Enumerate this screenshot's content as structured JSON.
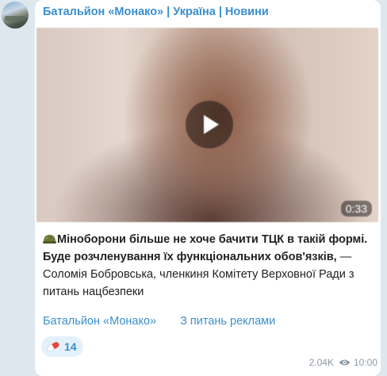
{
  "channel": {
    "title": "Батальйон «Монако» | Україна | Новини"
  },
  "video": {
    "duration": "0:33"
  },
  "post": {
    "headline": "Міноборони більше не хоче бачити ТЦК в такій формі. Буде розчленування їх функціональних обов'язків,",
    "body": " — Соломія Бобровська, членкиня Комітету Верховної Ради з питань нацбезпеки"
  },
  "links": {
    "channel_link": "Батальйон «Монако»",
    "ads_link": "З питань реклами"
  },
  "reaction": {
    "icon": "pill-icon",
    "count": "14"
  },
  "meta": {
    "views": "2.04K",
    "time": "10:00"
  },
  "colors": {
    "accent": "#3a8fd0",
    "background": "#dfe7ee"
  }
}
